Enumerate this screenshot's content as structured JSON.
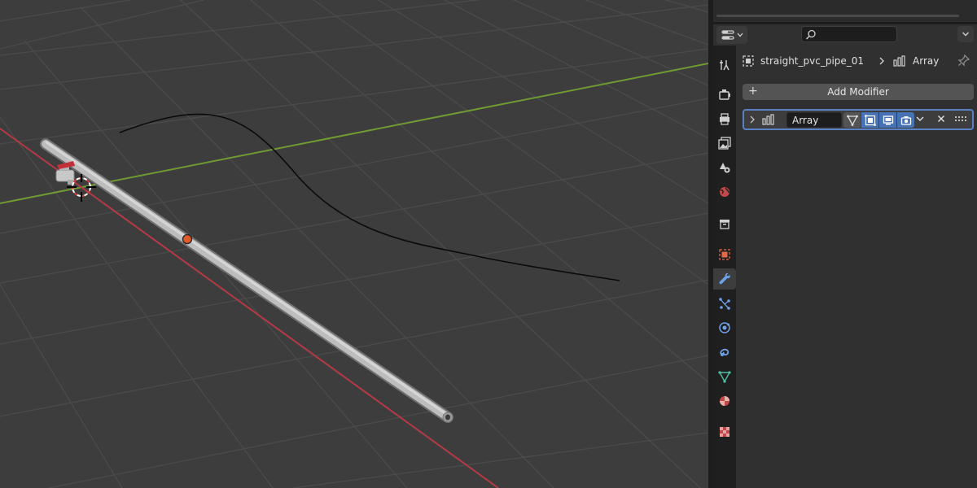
{
  "properties_editor": {
    "breadcrumb": {
      "object_name": "straight_pvc_pipe_01",
      "modifier_name": "Array"
    },
    "add_modifier_label": "Add Modifier",
    "modifier": {
      "name": "Array",
      "edit_mode_on": false,
      "on_cage_on": true,
      "realtime_on": true,
      "render_on": true
    },
    "tabs": [
      {
        "name": "tool",
        "icon": "tool-icon"
      },
      {
        "name": "render",
        "icon": "render-icon"
      },
      {
        "name": "output",
        "icon": "output-icon"
      },
      {
        "name": "view-layer",
        "icon": "view-layer-icon"
      },
      {
        "name": "scene",
        "icon": "scene-icon"
      },
      {
        "name": "world",
        "icon": "world-icon"
      },
      {
        "name": "collection",
        "icon": "collection-icon"
      },
      {
        "name": "object",
        "icon": "object-icon"
      },
      {
        "name": "modifiers",
        "icon": "wrench-icon",
        "active": true
      },
      {
        "name": "particles",
        "icon": "particles-icon"
      },
      {
        "name": "physics",
        "icon": "physics-icon"
      },
      {
        "name": "constraints",
        "icon": "constraints-icon"
      },
      {
        "name": "data",
        "icon": "mesh-data-icon"
      },
      {
        "name": "material",
        "icon": "material-icon"
      },
      {
        "name": "texture",
        "icon": "texture-icon"
      }
    ]
  },
  "viewport": {
    "x_axis_color": "#b53a46",
    "y_axis_color": "#6f9b32",
    "background": "#3d3d3d"
  },
  "colors": {
    "accent_blue": "#4772b3",
    "active_outline": "#5b80c4",
    "panel_bg": "#303030"
  }
}
